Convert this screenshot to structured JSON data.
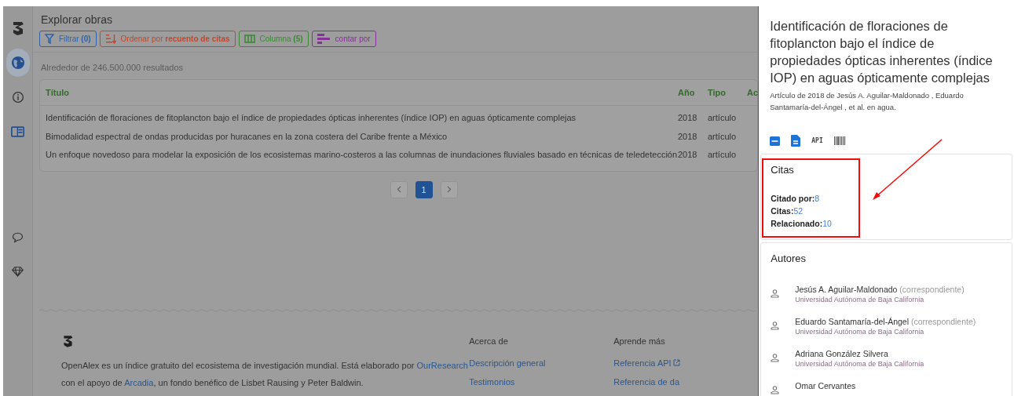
{
  "sidebar": {
    "top_items": [
      {
        "kind": "logo",
        "selected": false
      },
      {
        "kind": "globe",
        "selected": true
      },
      {
        "kind": "info",
        "selected": false
      },
      {
        "kind": "panel",
        "selected": false
      }
    ],
    "bottom_items": [
      {
        "kind": "chat",
        "selected": false
      },
      {
        "kind": "gem",
        "selected": false
      }
    ]
  },
  "header": {
    "title": "Explorar obras",
    "buttons": [
      {
        "kind": "filter",
        "label": "Filtrar **(0)**",
        "color": "#2f62a8"
      },
      {
        "kind": "sort",
        "label": "Ordenar por **recuento de citas**",
        "color": "#c4472c"
      },
      {
        "kind": "columns",
        "label": "Columna **(5)**",
        "color": "#3a8a34"
      },
      {
        "kind": "bars",
        "label": "contar por",
        "color": "#87319a"
      }
    ]
  },
  "results_count": "Alrededor de 246.500.000 resultados",
  "table": {
    "columns": [
      "Título",
      "Año",
      "Tipo",
      "Ac"
    ],
    "rows": [
      {
        "cells": [
          "Identificación de floraciones de fitoplancton bajo el índice de propiedades ópticas inherentes (índice IOP) en aguas ópticamente complejas",
          "2018",
          "artículo"
        ]
      },
      {
        "cells": [
          "Bimodalidad espectral de ondas producidas por huracanes en la zona costera del Caribe frente a México",
          "2018",
          "artículo"
        ]
      },
      {
        "cells": [
          "Un enfoque novedoso para modelar la exposición de los ecosistemas marino-costeros a las columnas de inundaciones fluviales basado en técnicas de teledetección",
          "2018",
          "artículo"
        ]
      }
    ]
  },
  "pagination": {
    "pages": [
      {
        "label": "1",
        "selected": true
      }
    ]
  },
  "footer": {
    "about": [
      {
        "text": "OpenAlex es un índice gratuito del ecosistema de investigación mundial. Está elaborado por ",
        "link": false
      },
      {
        "text": "OurResearch",
        "link": true
      },
      {
        "text": " con el apoyo de ",
        "link": false
      },
      {
        "text": "Arcadia",
        "link": true
      },
      {
        "text": ", un fondo benéfico de Lisbet Rausing y Peter Baldwin.",
        "link": false
      }
    ],
    "columns": [
      {
        "heading": "Acerca de",
        "links": [
          {
            "text": "Descripción general",
            "external": false
          },
          {
            "text": "Testimonios",
            "external": false
          }
        ]
      },
      {
        "heading": "Aprende más",
        "links": [
          {
            "text": "Referencia API",
            "external": true
          },
          {
            "text": "Referencia de da",
            "external": false
          }
        ]
      }
    ]
  },
  "drawer": {
    "title": "Identificación de floraciones de fitoplancton bajo el índice de propiedades ópticas inherentes (índice IOP) en aguas ópticamente complejas",
    "byline": "Artículo de 2018  de  Jesús A. Aguilar-Maldonado , Eduardo Santamaría-del-Ángel , et al. en agua.",
    "tools": [
      {
        "kind": "pdf"
      },
      {
        "kind": "doc"
      },
      {
        "kind": "text",
        "label": "API"
      },
      {
        "kind": "barcode"
      }
    ],
    "citations": {
      "title": "Citas",
      "highlighted": true,
      "rows": [
        {
          "label": "Citado por:",
          "value": "8"
        },
        {
          "label": "Citas:",
          "value": "52"
        },
        {
          "label": "Relacionado:",
          "value": "10"
        }
      ]
    },
    "authors": {
      "title": "Autores",
      "items": [
        {
          "name": "Jesús A. Aguilar-Maldonado",
          "role": "(correspondiente)",
          "affiliation": "Universidad Autónoma de Baja California"
        },
        {
          "name": "Eduardo Santamaría-del-Ángel",
          "role": "(correspondiente)",
          "affiliation": "Universidad Autónoma de Baja California"
        },
        {
          "name": "Adriana González Silvera",
          "affiliation": "Universidad Autónoma de Baja California"
        },
        {
          "name": "Omar Cervantes"
        }
      ]
    }
  }
}
